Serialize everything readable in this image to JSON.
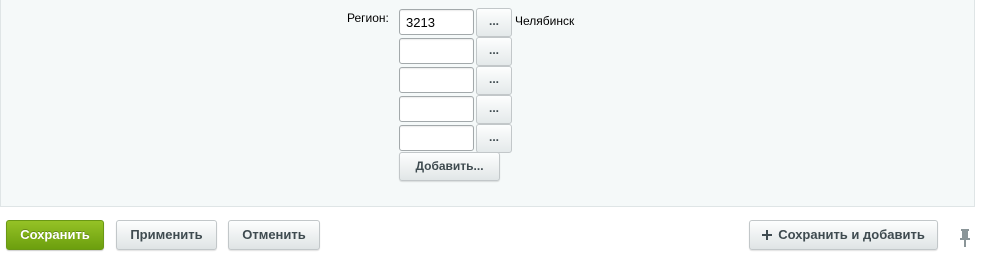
{
  "form": {
    "region_label": "Регион:",
    "region_rows": [
      {
        "value": "3213",
        "browse_label": "...",
        "city": "Челябинск"
      },
      {
        "value": "",
        "browse_label": "...",
        "city": ""
      },
      {
        "value": "",
        "browse_label": "...",
        "city": ""
      },
      {
        "value": "",
        "browse_label": "...",
        "city": ""
      },
      {
        "value": "",
        "browse_label": "...",
        "city": ""
      }
    ],
    "add_label": "Добавить..."
  },
  "footer": {
    "save_label": "Сохранить",
    "apply_label": "Применить",
    "cancel_label": "Отменить",
    "save_and_add_label": "Сохранить и добавить",
    "save_and_add_icon": "plus-icon",
    "pin_icon": "pin-icon"
  },
  "colors": {
    "save_button": "#7aab14",
    "panel_background": "#f5f9f9"
  }
}
